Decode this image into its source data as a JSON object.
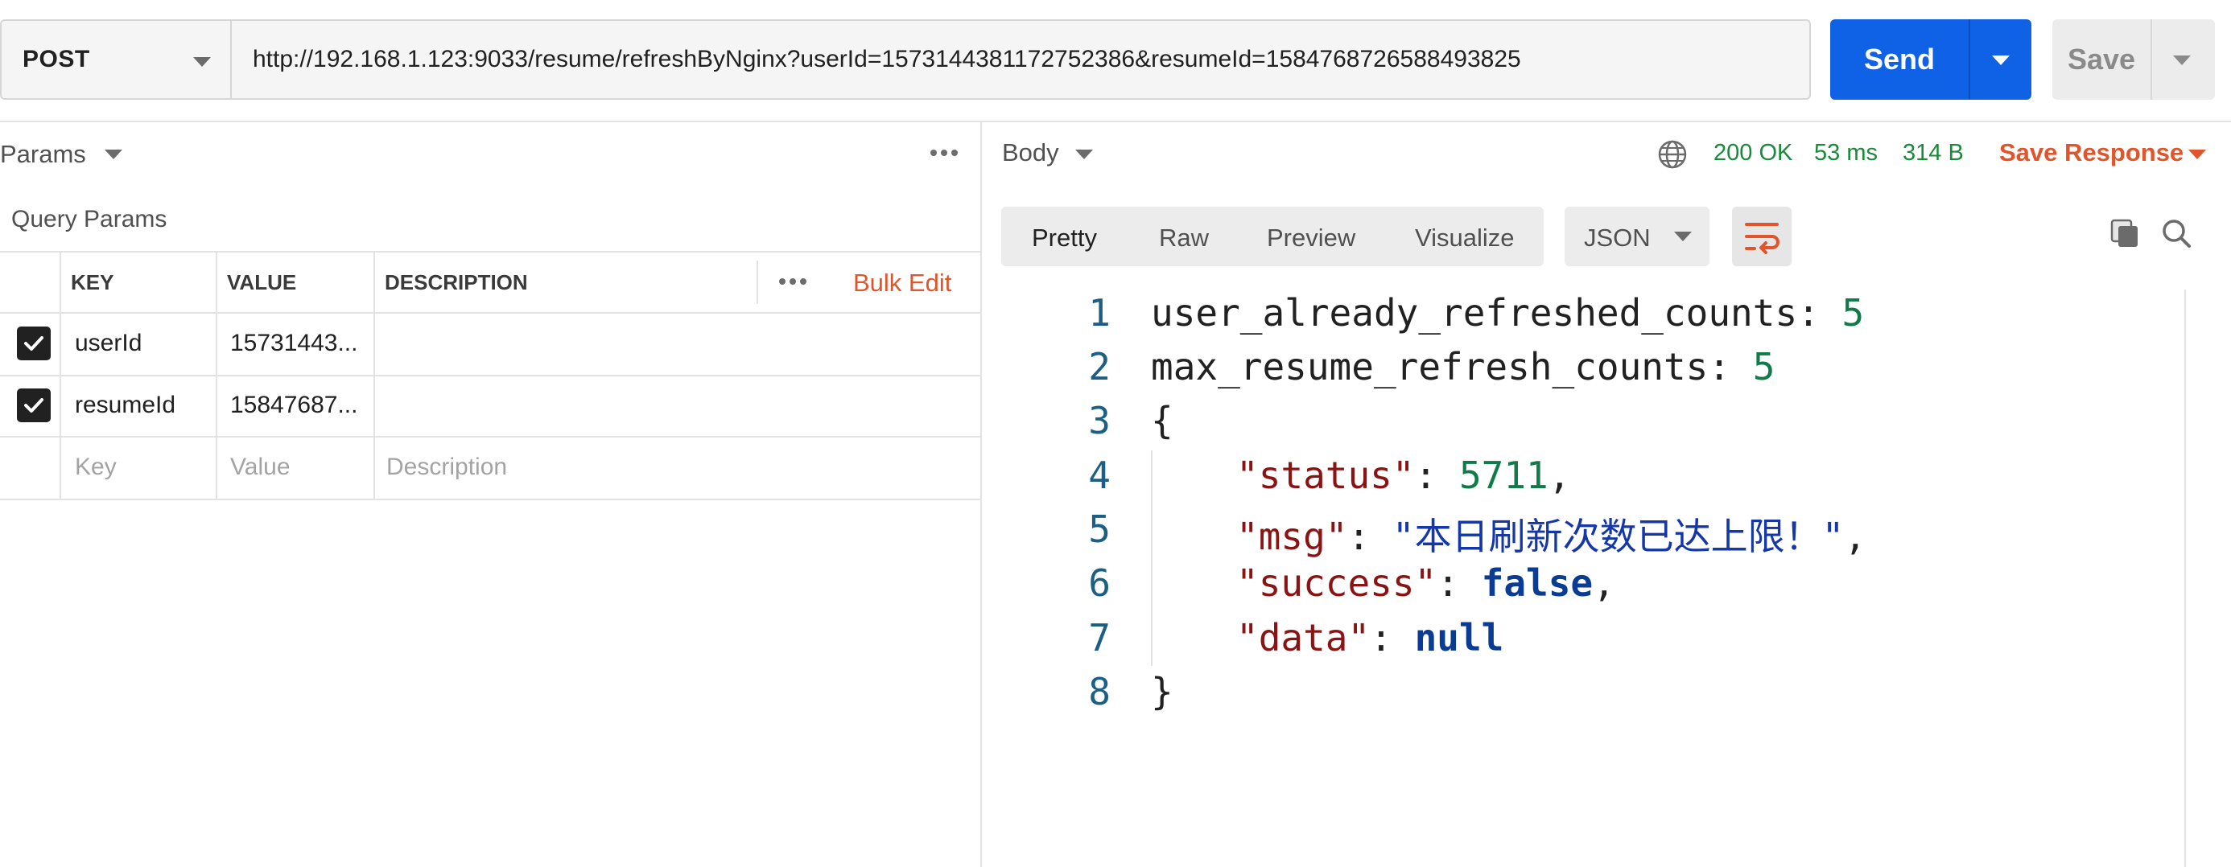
{
  "request": {
    "method": "POST",
    "url": "http://192.168.1.123:9033/resume/refreshByNginx?userId=1573144381172752386&resumeId=1584768726588493825",
    "send_label": "Send",
    "save_label": "Save"
  },
  "params_panel": {
    "title": "Params",
    "section_label": "Query Params",
    "columns": {
      "key": "KEY",
      "value": "VALUE",
      "description": "DESCRIPTION"
    },
    "bulk_edit_label": "Bulk Edit",
    "rows": [
      {
        "checked": true,
        "key": "userId",
        "value": "15731443...",
        "description": ""
      },
      {
        "checked": true,
        "key": "resumeId",
        "value": "15847687...",
        "description": ""
      }
    ],
    "placeholder": {
      "key": "Key",
      "value": "Value",
      "description": "Description"
    }
  },
  "response_panel": {
    "title": "Body",
    "status": "200 OK",
    "time": "53 ms",
    "size": "314 B",
    "save_response_label": "Save Response",
    "tabs": [
      "Pretty",
      "Raw",
      "Preview",
      "Visualize"
    ],
    "active_tab": "Pretty",
    "format": "JSON",
    "line_numbers": [
      "1",
      "2",
      "3",
      "4",
      "5",
      "6",
      "7",
      "8"
    ],
    "body": {
      "line1_key": "user_already_refreshed_counts: ",
      "line1_val": "5",
      "line2_key": "max_resume_refresh_counts: ",
      "line2_val": "5",
      "open_brace": "{",
      "status_key": "\"status\"",
      "status_val": "5711",
      "msg_key": "\"msg\"",
      "msg_val": "\"本日刷新次数已达上限！\"",
      "success_key": "\"success\"",
      "success_val": "false",
      "data_key": "\"data\"",
      "data_val": "null",
      "close_brace": "}"
    }
  },
  "colors": {
    "send_button": "#0f62e6",
    "status_ok": "#1a8a3a",
    "accent_orange": "#e0552b"
  },
  "icons": [
    "caret-down-icon",
    "more-horizontal-icon",
    "checkbox-checked-icon",
    "globe-icon",
    "wrap-lines-icon",
    "copy-icon",
    "search-icon"
  ]
}
